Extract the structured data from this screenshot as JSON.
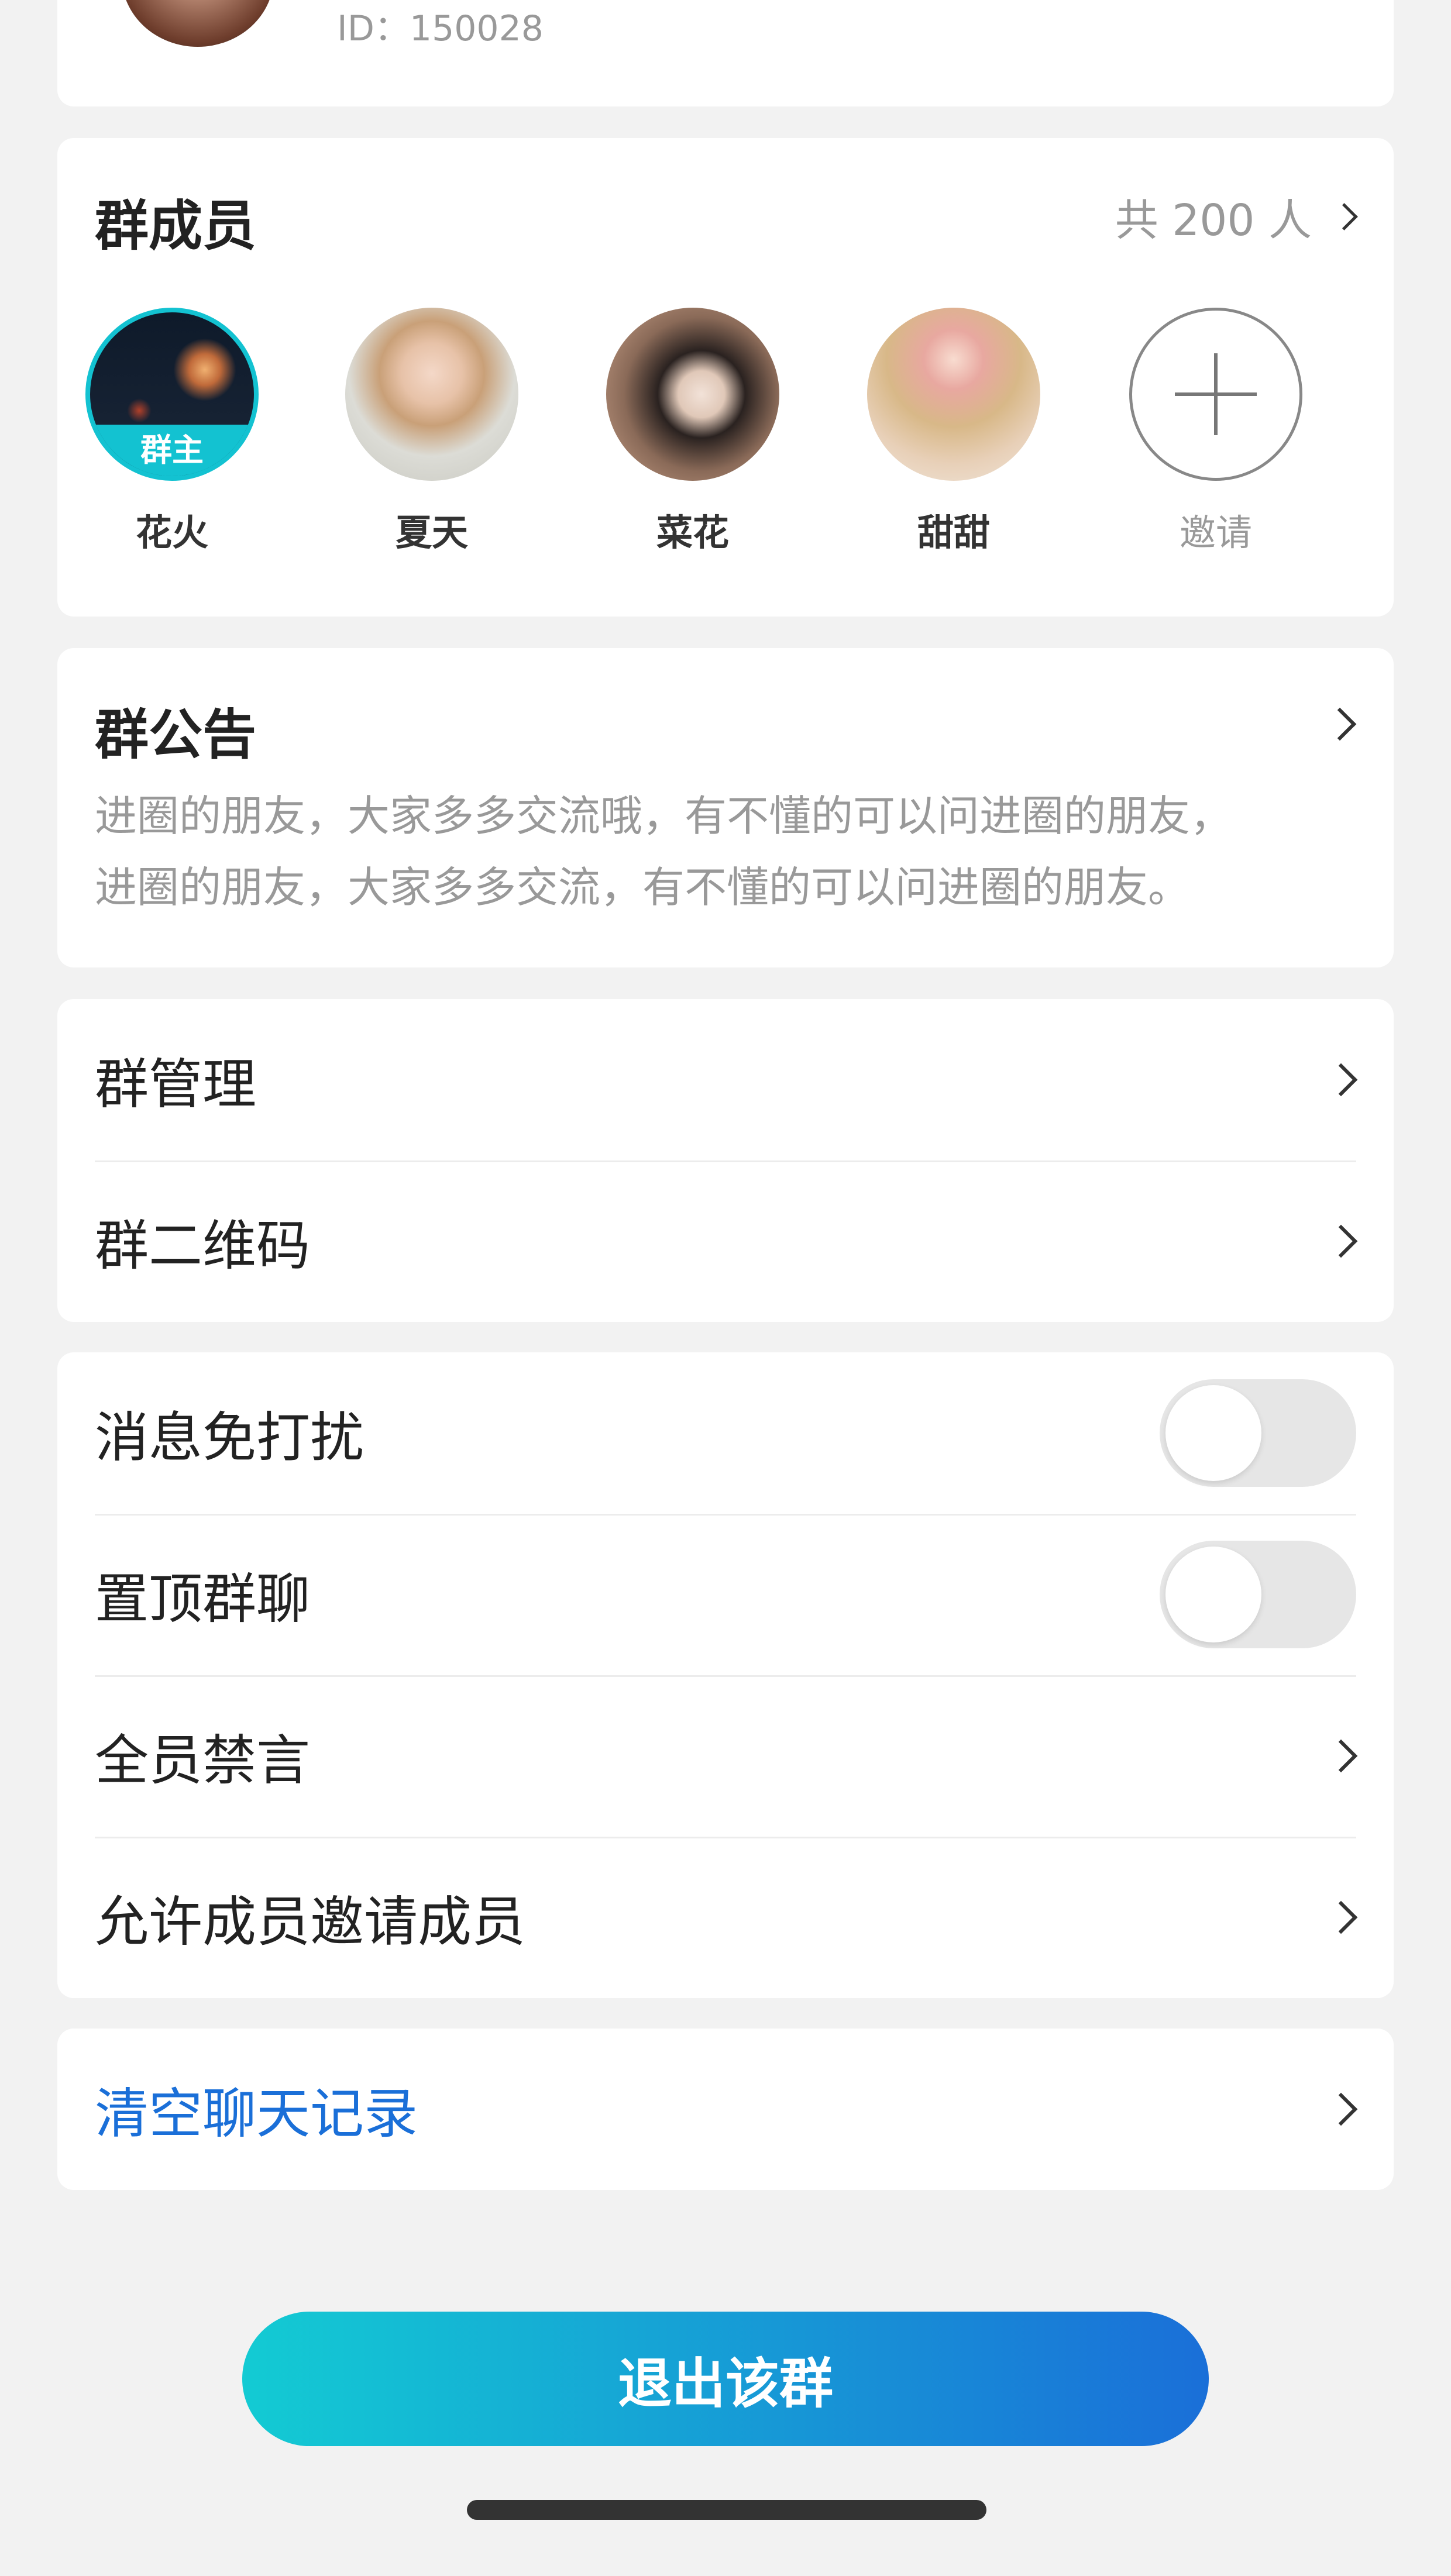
{
  "profile": {
    "id_text": "ID：150028"
  },
  "members": {
    "title": "群成员",
    "count_text": "共 200 人",
    "owner_badge": "群主",
    "list": [
      {
        "name": "花火"
      },
      {
        "name": "夏天"
      },
      {
        "name": "菜花"
      },
      {
        "name": "甜甜"
      }
    ],
    "invite_label": "邀请"
  },
  "announcement": {
    "title": "群公告",
    "lines": [
      "进圈的朋友，大家多多交流哦，有不懂的可以问进圈的朋友，",
      "进圈的朋友，大家多多交流，有不懂的可以问进圈的朋友。"
    ]
  },
  "manage": {
    "group_manage": "群管理",
    "group_qr": "群二维码"
  },
  "settings": {
    "mute_notifications": "消息免打扰",
    "mute_notifications_on": false,
    "pin_chat": "置顶群聊",
    "pin_chat_on": false,
    "mute_all": "全员禁言",
    "allow_invite": "允许成员邀请成员"
  },
  "clear_history": "清空聊天记录",
  "quit_button": "退出该群",
  "colors": {
    "accent_blue": "#1a6fd8",
    "gradient_start": "#13cbd3",
    "gradient_end": "#1a6fd8",
    "owner_ring": "#13c2d1"
  }
}
